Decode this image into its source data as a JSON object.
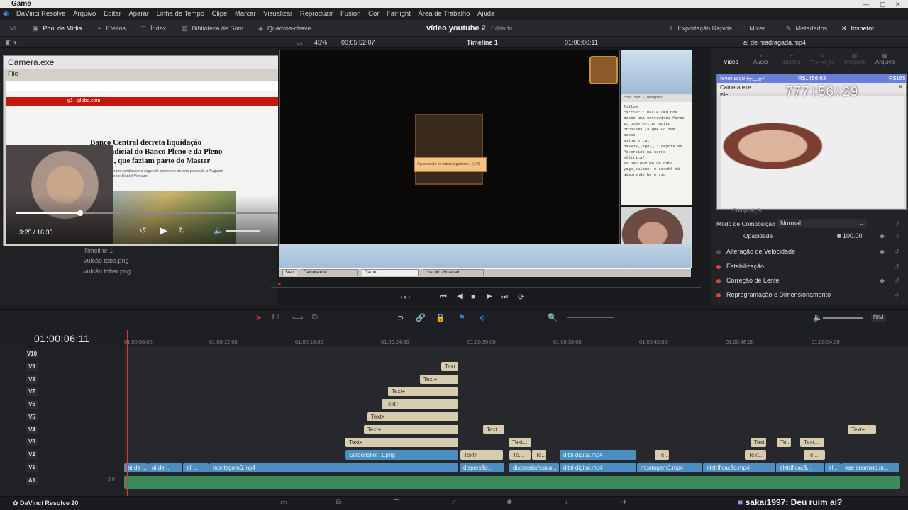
{
  "window": {
    "title": "Game"
  },
  "menu": [
    "DaVinci Resolve",
    "Arquivo",
    "Editar",
    "Aparar",
    "Linha de Tempo",
    "Clipe",
    "Marcar",
    "Visualizar",
    "Reproduzir",
    "Fusion",
    "Cor",
    "Fairlight",
    "Área de Trabalho",
    "Ajuda"
  ],
  "toolbar": {
    "media_pool": "Pool de Mídia",
    "effects": "Efeitos",
    "index": "Índex",
    "sound_library": "Biblioteca de Som",
    "keyframes": "Quadros-chave",
    "project_title": "vídeo youtube 2",
    "project_status": "Editado",
    "quick_export": "Exportação Rápida",
    "mixer": "Mixer",
    "metadata": "Metadados",
    "inspector": "Inspetor"
  },
  "viewer_bar": {
    "zoom": "45%",
    "duration": "00:05:52:07",
    "timeline_name": "Timeline 1",
    "timecode": "01:00:06:11",
    "clip_name": "aí de madragada.mp4"
  },
  "camera_window_1": {
    "title": "Camera.exe",
    "menu_file": "File",
    "article_source": "g1 · globo.com",
    "article_headline": "Banco Central decreta liquidação extrajudicial do Banco Pleno e da Pleno DTVM, que faziam parte do Master",
    "article_sub": "Instituições foram vendidas no segundo semestre do ano passado a Augusto Lima, ex-sócio de Daniel Vorcaro",
    "video_time": "3:25 / 16:36"
  },
  "game": {
    "dialog": "Aguardando os outros jogadores... (1/2)"
  },
  "chat_panel": {
    "title": "chat.txt - Notepad",
    "lines": [
      "follow",
      "carrierl: mas é uma boa",
      "mesmo uma entrevista Paris",
      "vc pode evitar muito",
      "problema já que vc tem esses",
      "anjos e tal",
      "pessoa_legal_l: depois de",
      "\"exorcize na serra elétrica\"",
      "eu não duvido de nada",
      "yago_caiano: o seachê tá",
      "demorando hoje viu"
    ]
  },
  "taskbar": {
    "start": "Start",
    "items": [
      "Camera.exe",
      "Game",
      "chat.txt - Notepad"
    ]
  },
  "camera_window_2": {
    "title": "Camera.exe",
    "menu_file": "File",
    "overlay_left": "fev/março (╥﹏╥)",
    "overlay_right": "R$1456.63",
    "overlay_far": "R$165",
    "counter": "777:56:29"
  },
  "inspector": {
    "tabs": [
      "Vídeo",
      "Áudio",
      "Efeitos",
      "Transição",
      "Imagem",
      "Arquivo"
    ],
    "composite_label": "Composição",
    "composite_mode_label": "Modo de Composição",
    "composite_mode_value": "Normal",
    "opacity_label": "Opacidade",
    "opacity_value": "100.00",
    "sections": [
      "Alteração de Velocidade",
      "Estabilização",
      "Correção de Lente",
      "Reprogramação e Dimensionamento"
    ]
  },
  "media_pool": {
    "items": [
      "Timeline 1",
      "vulcão toba.png",
      "vulcão tobar.png"
    ]
  },
  "timeline": {
    "timecode": "01:00:06:11",
    "ruler": [
      "01:00:06:00",
      "01:00:12:00",
      "01:00:18:00",
      "01:00:24:00",
      "01:00:30:00",
      "01:00:36:00",
      "01:00:42:00",
      "01:00:48:00",
      "01:00:54:00"
    ],
    "tracks": [
      "V10",
      "V9",
      "V8",
      "V7",
      "V6",
      "V5",
      "V4",
      "V3",
      "V2",
      "V1",
      "A1"
    ],
    "audio_level": "2.0",
    "dim_label": "DIM",
    "text_clip": "Text+",
    "text_short": "Text...",
    "text_short2": "Te...",
    "v2_clips": [
      "Screenshot_1.png",
      "dital digital.mp4"
    ],
    "v1_clips": [
      "aí de ...",
      "aí de ...",
      "aí ...",
      "montagem6.mp4",
      "dispersão...",
      "dispersão/ssica...",
      "dital digital.mp4",
      "montagem6.mp4",
      "eletrificação.mp4",
      "eletrificaçã...",
      "el...",
      "ese anomino.m..."
    ]
  },
  "footer": {
    "app": "DaVinci Resolve 20",
    "chat_user": "sakai1997",
    "chat_msg": ": Deu ruim aí?"
  }
}
